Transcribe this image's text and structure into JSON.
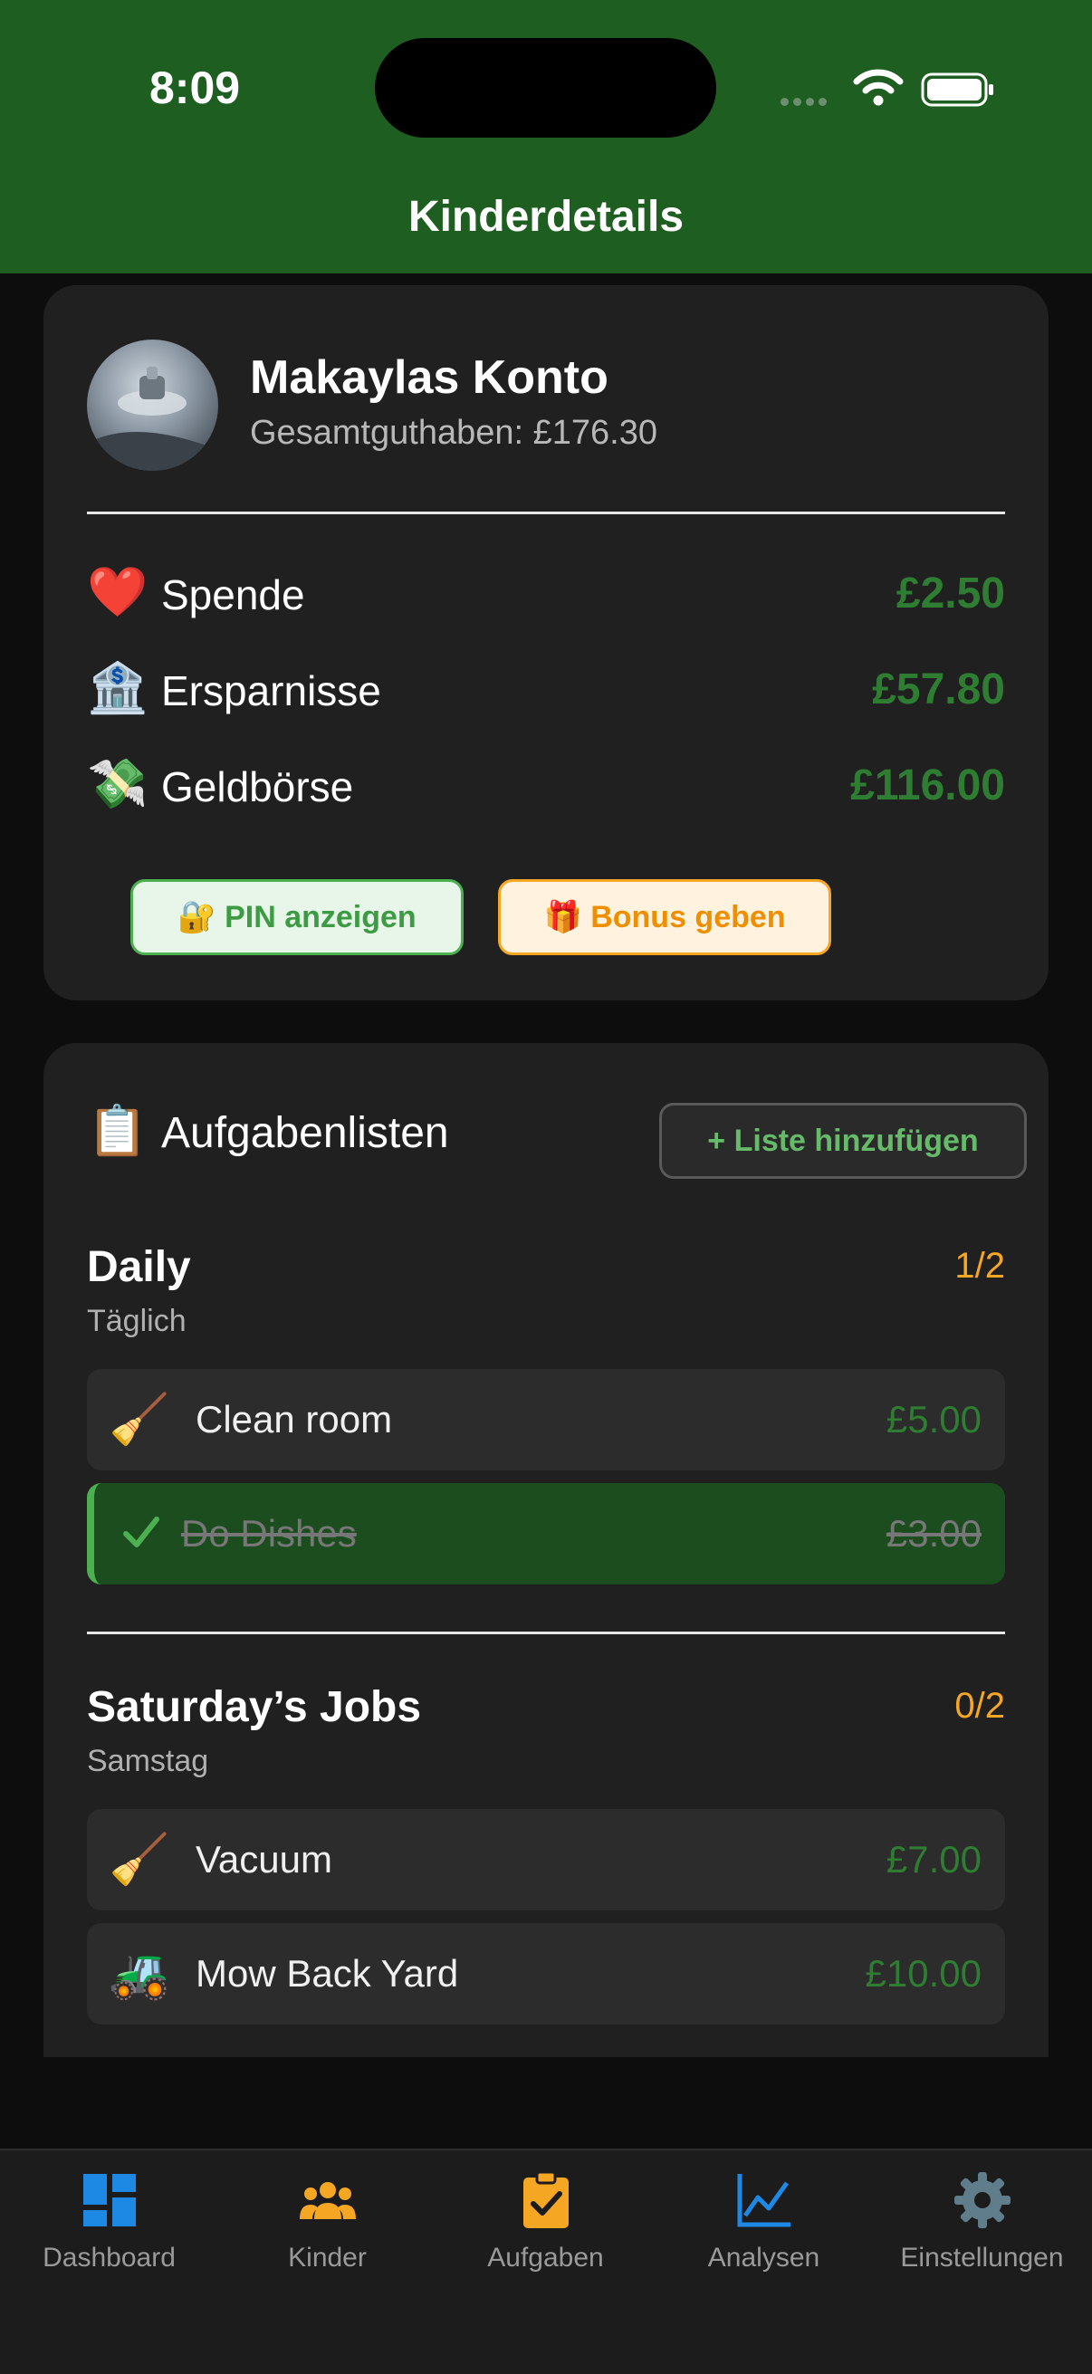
{
  "status_bar": {
    "time": "8:09"
  },
  "header": {
    "title": "Kinderdetails"
  },
  "account": {
    "name": "Makaylas Konto",
    "total": "Gesamtguthaben: £176.30",
    "balances": [
      {
        "icon": "❤️",
        "icon_name": "heart-icon",
        "label": "Spende",
        "value": "£2.50"
      },
      {
        "icon": "🏦",
        "icon_name": "bank-icon",
        "label": "Ersparnisse",
        "value": "£57.80"
      },
      {
        "icon": "💸",
        "icon_name": "money-wings-icon",
        "label": "Geldbörse",
        "value": "£116.00"
      }
    ],
    "pin_button": "🔐 PIN anzeigen",
    "bonus_button": "🎁 Bonus geben"
  },
  "tasks": {
    "title_icon": "📋",
    "title": "Aufgabenlisten",
    "add_button": "+ Liste hinzufügen",
    "lists": [
      {
        "name": "Daily",
        "schedule": "Täglich",
        "count": "1/2",
        "items": [
          {
            "icon": "🧹",
            "label": "Clean room",
            "value": "£5.00",
            "done": false
          },
          {
            "icon": "✓",
            "label": "Do Dishes",
            "value": "£3.00",
            "done": true
          }
        ]
      },
      {
        "name": "Saturday’s Jobs",
        "schedule": "Samstag",
        "count": "0/2",
        "items": [
          {
            "icon": "🧹",
            "label": "Vacuum",
            "value": "£7.00",
            "done": false
          },
          {
            "icon": "🚜",
            "label": "Mow Back Yard",
            "value": "£10.00",
            "done": false
          }
        ]
      }
    ]
  },
  "tabbar": {
    "tabs": [
      {
        "label": "Dashboard",
        "icon": "dashboard-icon",
        "color": "#1e88e5"
      },
      {
        "label": "Kinder",
        "icon": "people-icon",
        "color": "#f5a623"
      },
      {
        "label": "Aufgaben",
        "icon": "clipboard-check-icon",
        "color": "#f5a623"
      },
      {
        "label": "Analysen",
        "icon": "chart-line-icon",
        "color": "#1e88e5"
      },
      {
        "label": "Einstellungen",
        "icon": "gear-icon",
        "color": "#607d8b"
      }
    ]
  },
  "colors": {
    "header": "#1e5e20",
    "money_green": "#2e7d32",
    "accent_orange": "#f5a623"
  }
}
